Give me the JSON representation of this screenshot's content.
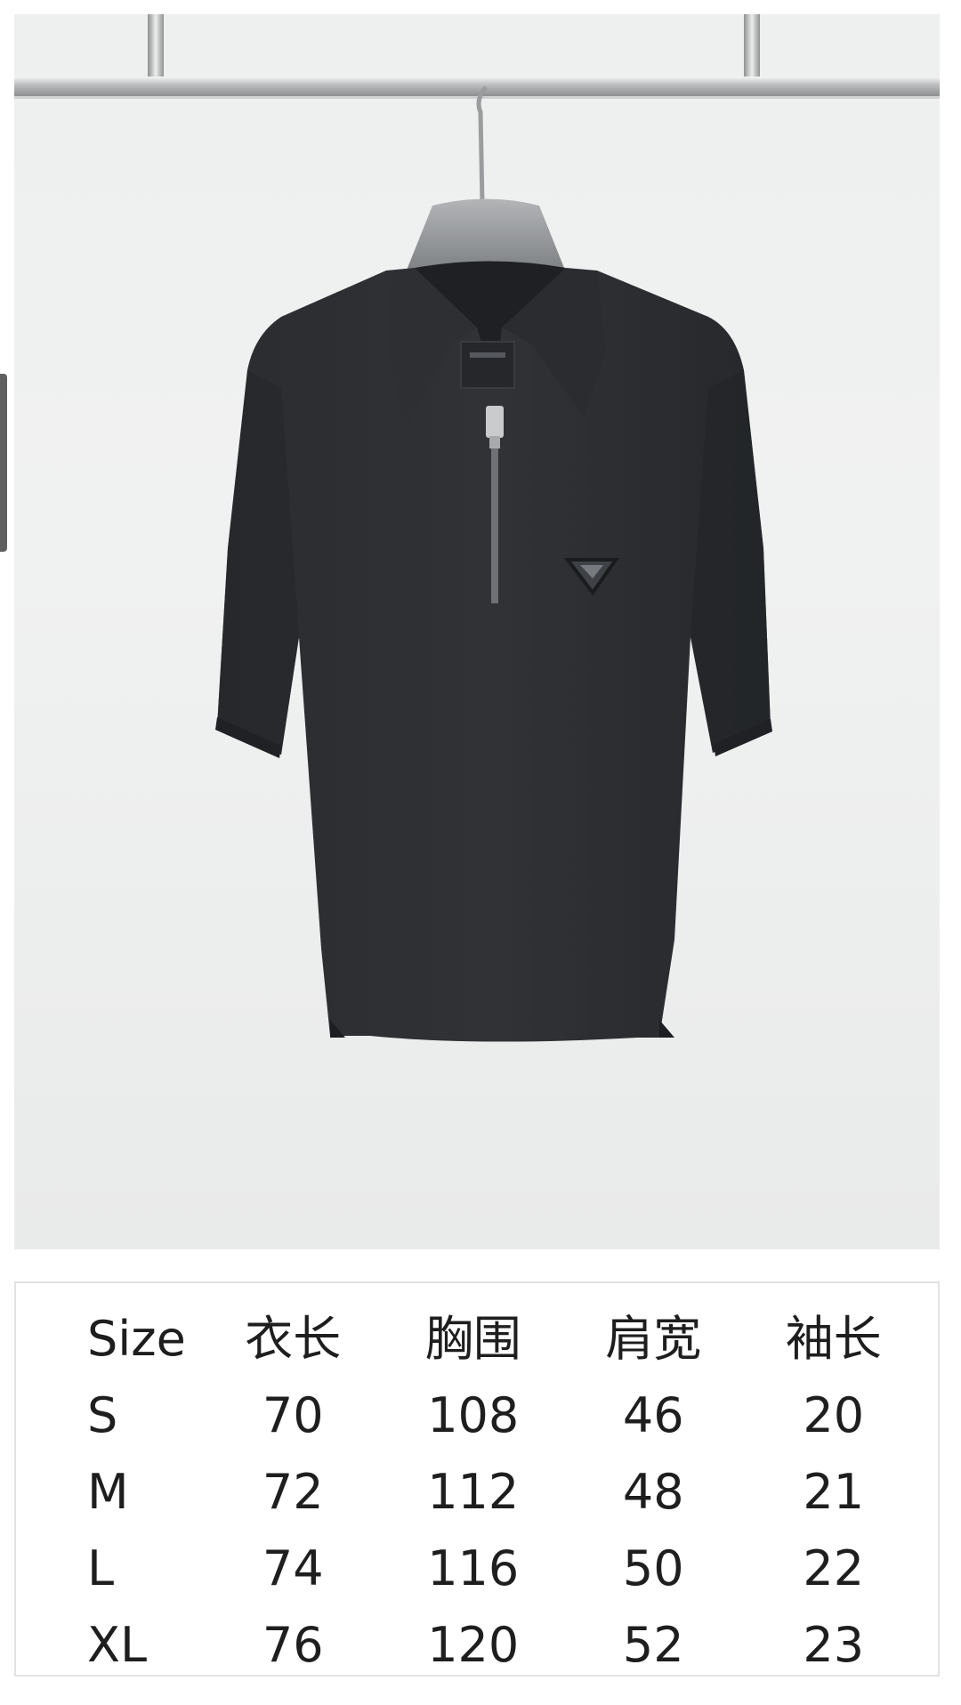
{
  "size_chart": {
    "headers": [
      "Size",
      "衣长",
      "胸围",
      "肩宽",
      "袖长"
    ],
    "rows": [
      [
        "S",
        "70",
        "108",
        "46",
        "20"
      ],
      [
        "M",
        "72",
        "112",
        "48",
        "21"
      ],
      [
        "L",
        "74",
        "116",
        "50",
        "22"
      ],
      [
        "XL",
        "76",
        "120",
        "52",
        "23"
      ]
    ]
  },
  "colors": {
    "shirt": "#2b2d30",
    "background": "#eef0ef",
    "rail": "#c9cbcc",
    "text": "#1e1e1e"
  },
  "icons": [
    "triangle-logo-badge",
    "zipper",
    "hanger"
  ]
}
